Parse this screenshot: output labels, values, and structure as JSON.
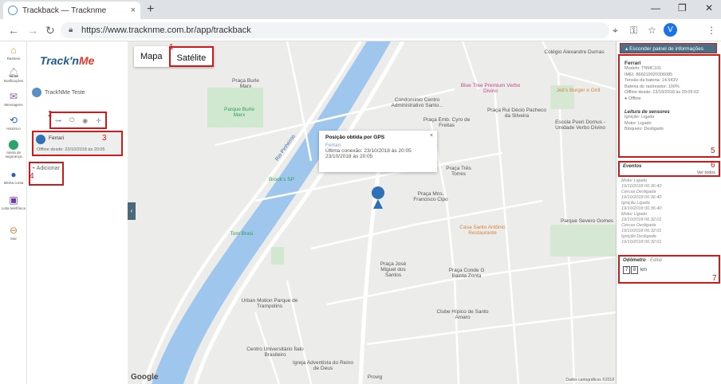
{
  "browser": {
    "tab_title": "Trackback — Tracknme",
    "tab_close": "×",
    "new_tab": "+",
    "url": "https://www.tracknme.com.br/app/trackback",
    "profile_initial": "V",
    "win_min": "—",
    "win_max": "❐",
    "win_close": "✕"
  },
  "leftbar": {
    "items": [
      {
        "label": "Rastreio"
      },
      {
        "label": "Notificações"
      },
      {
        "label": "Mensagens"
      },
      {
        "label": "Histórico"
      },
      {
        "label": "Alerta de segurança"
      },
      {
        "label": "Minha conta"
      },
      {
        "label": "Lista telefônica"
      },
      {
        "label": "Sair"
      }
    ]
  },
  "panel": {
    "logo_a": "Track'n",
    "logo_b": "Me",
    "user_name": "TrackNMe Teste",
    "vehicle_name": "Ferrari",
    "vehicle_status": "Offline desde: 23/10/2018 às 20:05",
    "add_label": "+ Adicionar",
    "marks": {
      "n2": "2",
      "n3": "3",
      "n4": "4"
    }
  },
  "map": {
    "type_map": "Mapa",
    "type_satellite": "Satélite",
    "mark_1": "1",
    "collapse_glyph": "‹",
    "infowindow": {
      "title": "Posição obtida por GPS",
      "name": "Ferrari",
      "last_connection": "Última conexão: 23/10/2018 às 20:05",
      "date_line": "23/10/2018 às 20:05",
      "close": "×"
    },
    "labels": {
      "praca_burle": "Praça Burle Marx",
      "parque_burle": "Parque Burle Marx",
      "condominio": "Condomínio Centro Administrativo Santo...",
      "blue_tree": "Blue Tree Premium Verbo Divino",
      "colegio": "Colégio Alexandre Dumas",
      "jeti": "Jeti's Burger e Grill",
      "praca_rui": "Praça Rui Décio Pacheco da Silveira",
      "escola": "Escola Pueri Domus - Unidade Verbo Divino",
      "praca_emb": "Praça Emb. Cyro de Freitas",
      "praca_tres": "Praça Três Torres",
      "brooks": "Brook's SP",
      "praca_mns": "Praça Mns. Francisco Cipo",
      "casa_santo": "Casa Santo Antônio Restaurante",
      "tom_brasi": "Tom Brasi",
      "parque_severo": "Parque Severo Gomes",
      "praca_jose": "Praça José Miguel dos Santos",
      "praca_conde": "Praça Conde G Baiota Zonta",
      "urban": "Urban Motion Parque de Trampolins",
      "clube": "Clube Hípico de Santo Amaro",
      "centro": "Centro Universitário Ítalo Brasileiro",
      "igreja": "Igreja Adventista do Reino de Deus",
      "provig": "Provig",
      "rio": "Rio Pinheiros",
      "google": "Google",
      "attrib": "Dados cartográficos ©2018"
    }
  },
  "infopanel": {
    "hide_label": "Esconder painel de informações",
    "vehicle": "Ferrari",
    "model": "Modelo: TNMC101",
    "imei": "IMEI: 866019020306085",
    "battery": "Tensão da bateria: 14.543V",
    "tracker_battery": "Bateria do rastreador: 100%",
    "offline_since": "Offline desde: 23/10/2018 às 20:05:02",
    "offline": "Offline",
    "sensors_title": "Leitura de sensores",
    "sensor_1": "Ignição: Ligada",
    "sensor_2": "Motor: Ligado",
    "sensor_3": "Bloqueio: Desligado",
    "events_title": "Eventos",
    "events_all": "Ver todos",
    "events": [
      {
        "name": "Motor Ligado",
        "date": "19/10/2018 06:36:40"
      },
      {
        "name": "Cercas Desligada",
        "date": "19/10/2018 06:36:40"
      },
      {
        "name": "Ignição Ligada",
        "date": "19/10/2018 06:36:40"
      },
      {
        "name": "Motor Ligado",
        "date": "19/10/2018 06:32:01"
      },
      {
        "name": "Cercas Desligada",
        "date": "19/10/2018 06:32:01"
      },
      {
        "name": "Ignição Desligada",
        "date": "19/10/2018 06:32:01"
      }
    ],
    "odometer_title": "Odômetro",
    "odometer_edit": "· Editar",
    "odometer_digits": [
      "7",
      "8"
    ],
    "odometer_unit": "km",
    "marks": {
      "n5": "5",
      "n6": "6",
      "n7": "7"
    }
  }
}
